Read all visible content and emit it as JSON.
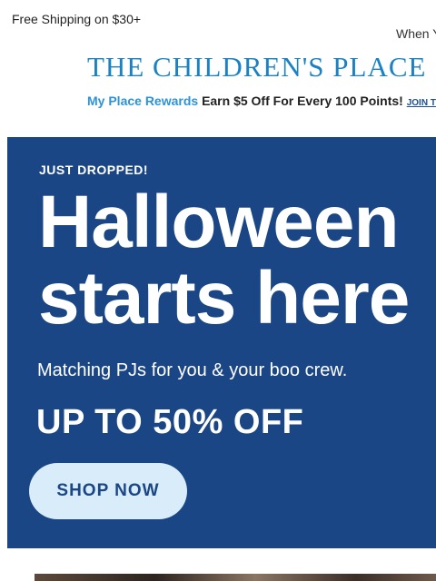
{
  "top_bar": {
    "shipping": "Free Shipping on $30+",
    "promo_partial": "When Y"
  },
  "brand": {
    "logo_text": "THE CHILDREN'S PLACE",
    "color": "#1a82c4"
  },
  "rewards": {
    "program": "My Place Rewards",
    "offer": "Earn $5 Off For Every 100 Points!",
    "join": "JOIN T"
  },
  "hero": {
    "kicker": "JUST DROPPED!",
    "headline_line1": "Halloween",
    "headline_line2": "starts here",
    "subline": "Matching PJs for you & your boo crew.",
    "offer": "UP TO 50% OFF",
    "cta": "SHOP NOW",
    "background": "#1a4686",
    "cta_background": "#d8ecf9"
  }
}
